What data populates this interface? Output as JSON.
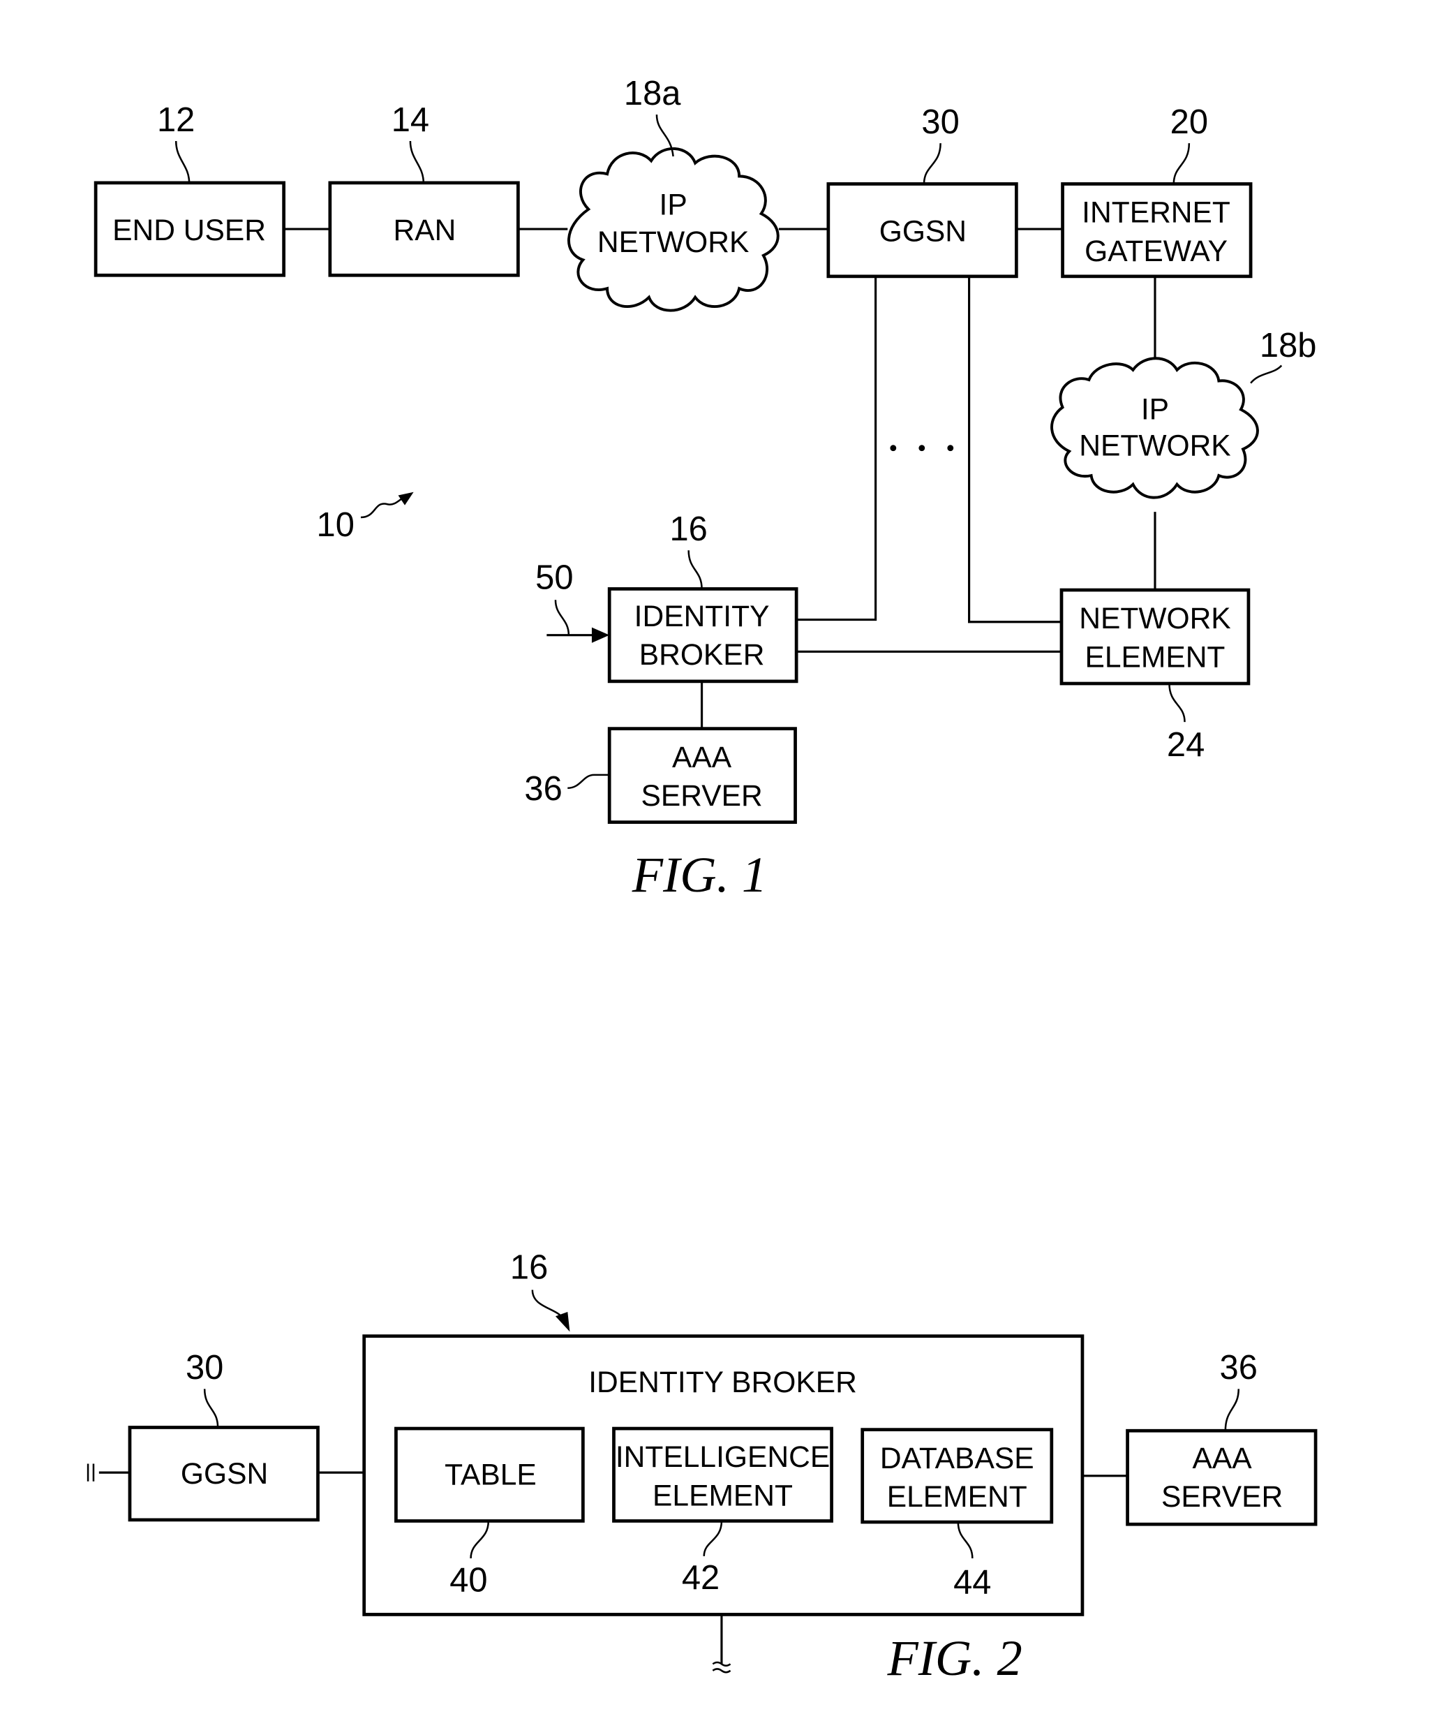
{
  "fig1": {
    "caption": "FIG. 1",
    "system_ref": "10",
    "nodes": {
      "end_user": {
        "ref": "12",
        "line1": "END USER"
      },
      "ran": {
        "ref": "14",
        "line1": "RAN"
      },
      "ip_network_a": {
        "ref": "18a",
        "line1": "IP",
        "line2": "NETWORK"
      },
      "ggsn": {
        "ref": "30",
        "line1": "GGSN"
      },
      "internet_gateway": {
        "ref": "20",
        "line1": "INTERNET",
        "line2": "GATEWAY"
      },
      "ip_network_b": {
        "ref": "18b",
        "line1": "IP",
        "line2": "NETWORK"
      },
      "identity_broker": {
        "ref": "16",
        "line1": "IDENTITY",
        "line2": "BROKER"
      },
      "aaa_server": {
        "ref": "36",
        "line1": "AAA",
        "line2": "SERVER"
      },
      "network_element": {
        "ref": "24",
        "line1": "NETWORK",
        "line2": "ELEMENT"
      }
    },
    "input_ref": "50",
    "ellipsis": "• • •"
  },
  "fig2": {
    "caption": "FIG. 2",
    "identity_broker": {
      "ref": "16",
      "title": "IDENTITY BROKER"
    },
    "ggsn": {
      "ref": "30",
      "line1": "GGSN"
    },
    "table": {
      "ref": "40",
      "line1": "TABLE"
    },
    "intelligence_element": {
      "ref": "42",
      "line1": "INTELLIGENCE",
      "line2": "ELEMENT"
    },
    "database_element": {
      "ref": "44",
      "line1": "DATABASE",
      "line2": "ELEMENT"
    },
    "aaa_server": {
      "ref": "36",
      "line1": "AAA",
      "line2": "SERVER"
    }
  }
}
